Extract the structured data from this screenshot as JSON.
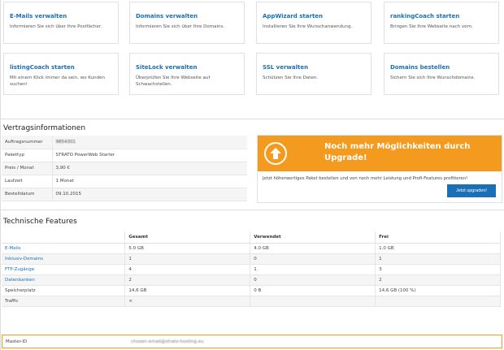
{
  "cards": [
    {
      "title": "E-Mails verwalten",
      "desc": "Informieren Sie sich über Ihre Postfächer."
    },
    {
      "title": "Domains verwalten",
      "desc": "Informieren Sie sich über Ihre Domains."
    },
    {
      "title": "AppWizard starten",
      "desc": "Installieren Sie Ihre Wunschanwendung."
    },
    {
      "title": "rankingCoach starten",
      "desc": "Bringen Sie Ihre Webseite nach vorn."
    },
    {
      "title": "listingCoach starten",
      "desc": "Mit einem Klick immer da sein, wo Kunden suchen!"
    },
    {
      "title": "SiteLock verwalten",
      "desc": "Überprüfen Sie Ihre Webseite auf Schwachstellen."
    },
    {
      "title": "SSL verwalten",
      "desc": "Schützen Sie Ihre Daten."
    },
    {
      "title": "Domains bestellen",
      "desc": "Sichern Sie sich Ihre Wunschdomains."
    }
  ],
  "vertrag": {
    "title": "Vertragsinformationen",
    "rows": [
      {
        "label": "Auftragsnummer",
        "value": "9854301"
      },
      {
        "label": "Pakettyp",
        "value": "STRATO PowerWeb Starter"
      },
      {
        "label": "Preis / Monat",
        "value": "3,90 €"
      },
      {
        "label": "Laufzeit",
        "value": "1 Monat"
      },
      {
        "label": "Bestelldatum",
        "value": "09.10.2015"
      }
    ]
  },
  "upgrade": {
    "title": "Noch mehr Möglichkeiten durch Upgrade!",
    "desc": "Jetzt höherwertiges Paket bestellen und von noch mehr Leistung und Profi-Features profitieren!",
    "button": "Jetzt upgraden!",
    "color": "#f39a1f",
    "icon": "arrow-up-circle-icon"
  },
  "features": {
    "title": "Technische Features",
    "headers": [
      "",
      "Gesamt",
      "Verwendet",
      "Frei"
    ],
    "rows": [
      {
        "name": "E-Mails",
        "gesamt": "5.0 GB",
        "verwendet": "4.0 GB",
        "frei": "1.0 GB"
      },
      {
        "name": "Inklusiv-Domains",
        "gesamt": "1",
        "verwendet": "0",
        "frei": "1"
      },
      {
        "name": "FTP-Zugänge",
        "gesamt": "4",
        "verwendet": "1",
        "frei": "3"
      },
      {
        "name": "Datenbanken",
        "gesamt": "2",
        "verwendet": "0",
        "frei": "2"
      },
      {
        "name": "Speicherplatz",
        "gesamt": "14,6 GB",
        "verwendet": "0 B",
        "frei": "14,6 GB (100 %)"
      },
      {
        "name": "Traffic",
        "gesamt": "∞",
        "verwendet": "",
        "frei": ""
      }
    ]
  },
  "master": {
    "label": "Master-ID",
    "value": "chosen-email@strato-hosting.eu"
  },
  "colors": {
    "link": "#1a6fb5",
    "accent": "#f39a1f"
  }
}
